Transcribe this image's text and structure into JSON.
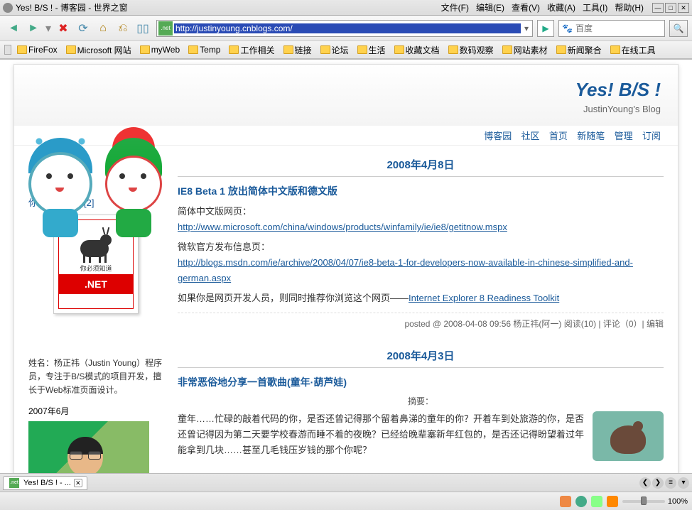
{
  "window": {
    "title": "Yes! B/S ! - 博客园 - 世界之窗"
  },
  "menu": {
    "file": "文件(F)",
    "edit": "编辑(E)",
    "view": "查看(V)",
    "favorites": "收藏(A)",
    "tools": "工具(I)",
    "help": "帮助(H)"
  },
  "url": "http://justinyoung.cnblogs.com/",
  "search": {
    "placeholder": "百度"
  },
  "bookmarks": [
    "FireFox",
    "Microsoft 网站",
    "myWeb",
    "Temp",
    "工作相关",
    "链接",
    "论坛",
    "生活",
    "收藏文档",
    "数码观察",
    "网站素材",
    "新闻聚合",
    "在线工具"
  ],
  "blog": {
    "title": "Yes! B/S !",
    "subtitle": "JustinYoung's Blog",
    "nav": {
      "home": "博客园",
      "community": "社区",
      "front": "首页",
      "newpost": "新随笔",
      "manage": "管理",
      "rss": "订阅"
    },
    "side": {
      "msg": "你有新短消息[2]",
      "book_small": "你必须知道",
      "book_band": ".NET",
      "bio": "姓名：杨正祎（Justin Young）程序员，专注于B/S模式的项目开发，擅长于Web标准页面设计。",
      "photo_date": "2007年6月"
    },
    "posts": [
      {
        "date": "2008年4月8日",
        "title": "IE8 Beta 1 放出简体中文版和德文版",
        "p1_label": "简体中文版网页：",
        "p1_link": "http://www.microsoft.com/china/windows/products/winfamily/ie/ie8/getitnow.mspx",
        "p2_label": "微软官方发布信息页：",
        "p2_link": "http://blogs.msdn.com/ie/archive/2008/04/07/ie8-beta-1-for-developers-now-available-in-chinese-simplified-and-german.aspx",
        "p3_prefix": "如果你是网页开发人员，则同时推荐你浏览这个网页——",
        "p3_link": "Internet Explorer 8 Readiness Toolkit",
        "footer": "posted @ 2008-04-08 09:56 杨正祎(阿一) 阅读(10) | 评论（0）| 编辑"
      },
      {
        "date": "2008年4月3日",
        "title": "非常恶俗地分享一首歌曲(童年·葫芦娃)",
        "summary_label": "摘要：",
        "summary": "童年……忙碌的敲着代码的你，是否还曾记得那个留着鼻涕的童年的你？开着车到处旅游的你，是否还曾记得因为第二天要学校春游而睡不着的夜晚？已经给晚辈塞新年红包的，是否还记得盼望着过年能拿到几块……甚至几毛钱压岁钱的那个你呢？"
      }
    ]
  },
  "tab": {
    "label": "Yes! B/S ! - ..."
  },
  "status": {
    "zoom": "100%"
  }
}
